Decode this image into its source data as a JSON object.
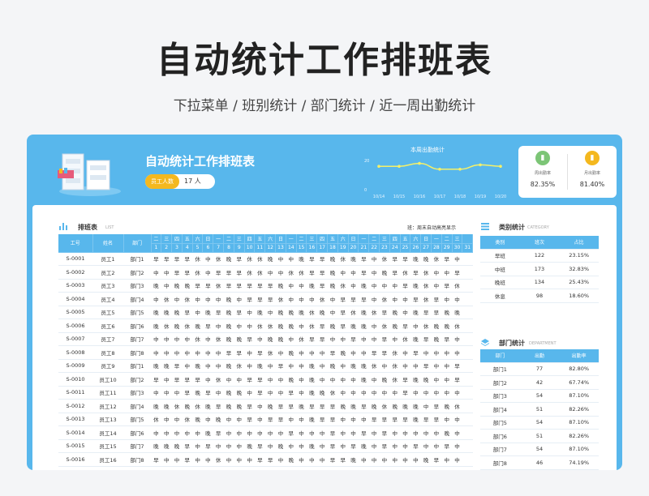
{
  "page_title": "自动统计工作排班表",
  "page_subtitle": "下拉菜单 / 班别统计 / 部门统计 / 近一周出勤统计",
  "header": {
    "title": "自动统计工作排班表",
    "staff_label": "员工人数",
    "staff_count": "17 人",
    "weekly_title": "本周出勤统计"
  },
  "stats": [
    {
      "label": "周出勤率",
      "value": "82.35%",
      "color": "#7cc576",
      "icon": "bar-icon"
    },
    {
      "label": "月出勤率",
      "value": "81.40%",
      "color": "#f4b81e",
      "icon": "bar-icon"
    }
  ],
  "chart_data": {
    "type": "line",
    "title": "本周出勤统计",
    "x": [
      "10/14",
      "10/15",
      "10/16",
      "10/17",
      "10/18",
      "10/19",
      "10/20"
    ],
    "values": [
      16,
      16,
      18,
      14,
      14,
      17,
      16
    ],
    "ylim": [
      0,
      20
    ],
    "yticks": [
      "20",
      "0"
    ],
    "color": "#f4f06a"
  },
  "schedule": {
    "title": "排班表",
    "title_en": "LIST",
    "note": "班：周末自动高亮显示",
    "col_id": "工号",
    "col_name": "姓名",
    "col_dept": "部门",
    "weekdays": [
      "二",
      "三",
      "四",
      "五",
      "六",
      "日",
      "一",
      "二",
      "三",
      "四",
      "五",
      "六",
      "日",
      "一",
      "二",
      "三",
      "四",
      "五",
      "六",
      "日",
      "一",
      "二",
      "三",
      "四",
      "五",
      "六",
      "日",
      "一",
      "二",
      "三"
    ],
    "days": [
      "1",
      "2",
      "3",
      "4",
      "5",
      "6",
      "7",
      "8",
      "9",
      "10",
      "11",
      "12",
      "13",
      "14",
      "15",
      "16",
      "17",
      "18",
      "19",
      "20",
      "21",
      "22",
      "23",
      "24",
      "25",
      "26",
      "27",
      "28",
      "29",
      "30",
      "31"
    ],
    "rows": [
      {
        "id": "S-0001",
        "name": "员工1",
        "dept": "部门1",
        "shifts": [
          "早",
          "早",
          "早",
          "早",
          "休",
          "中",
          "休",
          "晚",
          "早",
          "休",
          "休",
          "晚",
          "中",
          "中",
          "晚",
          "早",
          "早",
          "晚",
          "休",
          "晚",
          "早",
          "中",
          "休",
          "早",
          "早",
          "晚",
          "晚",
          "休",
          "早",
          "中"
        ]
      },
      {
        "id": "S-0002",
        "name": "员工2",
        "dept": "部门2",
        "shifts": [
          "中",
          "中",
          "早",
          "早",
          "休",
          "中",
          "早",
          "早",
          "早",
          "休",
          "休",
          "中",
          "中",
          "休",
          "休",
          "早",
          "早",
          "晚",
          "中",
          "中",
          "早",
          "中",
          "晚",
          "早",
          "休",
          "早",
          "休",
          "中",
          "中",
          "早"
        ]
      },
      {
        "id": "S-0003",
        "name": "员工3",
        "dept": "部门3",
        "shifts": [
          "晚",
          "中",
          "晚",
          "晚",
          "早",
          "早",
          "休",
          "早",
          "早",
          "早",
          "早",
          "早",
          "晚",
          "中",
          "中",
          "晚",
          "早",
          "晚",
          "休",
          "中",
          "晚",
          "中",
          "中",
          "中",
          "早",
          "晚",
          "休",
          "中",
          "早",
          "休"
        ]
      },
      {
        "id": "S-0004",
        "name": "员工4",
        "dept": "部门4",
        "shifts": [
          "中",
          "休",
          "中",
          "休",
          "中",
          "中",
          "中",
          "晚",
          "中",
          "早",
          "早",
          "早",
          "休",
          "中",
          "中",
          "中",
          "休",
          "中",
          "早",
          "早",
          "早",
          "中",
          "休",
          "中",
          "中",
          "早",
          "休",
          "早",
          "中",
          "中"
        ]
      },
      {
        "id": "S-0005",
        "name": "员工5",
        "dept": "部门5",
        "shifts": [
          "晚",
          "晚",
          "晚",
          "早",
          "中",
          "晚",
          "早",
          "晚",
          "早",
          "中",
          "晚",
          "中",
          "晚",
          "晚",
          "晚",
          "休",
          "晚",
          "中",
          "早",
          "休",
          "晚",
          "休",
          "早",
          "晚",
          "中",
          "晚",
          "早",
          "早",
          "晚",
          "晚"
        ]
      },
      {
        "id": "S-0006",
        "name": "员工6",
        "dept": "部门6",
        "shifts": [
          "晚",
          "休",
          "晚",
          "休",
          "晚",
          "早",
          "中",
          "晚",
          "中",
          "中",
          "休",
          "休",
          "晚",
          "晚",
          "中",
          "休",
          "早",
          "晚",
          "早",
          "晚",
          "晚",
          "中",
          "休",
          "晚",
          "早",
          "中",
          "休",
          "晚",
          "晚",
          "休"
        ]
      },
      {
        "id": "S-0007",
        "name": "员工7",
        "dept": "部门7",
        "shifts": [
          "中",
          "中",
          "中",
          "中",
          "休",
          "中",
          "休",
          "晚",
          "晚",
          "早",
          "中",
          "晚",
          "晚",
          "中",
          "休",
          "早",
          "早",
          "中",
          "中",
          "早",
          "中",
          "中",
          "早",
          "中",
          "休",
          "晚",
          "早",
          "晚",
          "早",
          "中"
        ]
      },
      {
        "id": "S-0008",
        "name": "员工8",
        "dept": "部门8",
        "shifts": [
          "中",
          "中",
          "中",
          "中",
          "中",
          "中",
          "中",
          "早",
          "早",
          "中",
          "早",
          "休",
          "中",
          "晚",
          "中",
          "中",
          "中",
          "早",
          "晚",
          "中",
          "中",
          "早",
          "早",
          "休",
          "中",
          "早",
          "中",
          "中",
          "中",
          "中"
        ]
      },
      {
        "id": "S-0009",
        "name": "员工9",
        "dept": "部门1",
        "shifts": [
          "晚",
          "晚",
          "早",
          "中",
          "晚",
          "中",
          "中",
          "晚",
          "休",
          "中",
          "晚",
          "中",
          "早",
          "中",
          "中",
          "晚",
          "中",
          "晚",
          "中",
          "晚",
          "晚",
          "休",
          "中",
          "休",
          "中",
          "中",
          "早",
          "中",
          "中",
          "早"
        ]
      },
      {
        "id": "S-0010",
        "name": "员工10",
        "dept": "部门2",
        "shifts": [
          "早",
          "中",
          "早",
          "早",
          "早",
          "中",
          "休",
          "中",
          "中",
          "早",
          "早",
          "中",
          "中",
          "晚",
          "中",
          "晚",
          "中",
          "中",
          "中",
          "中",
          "晚",
          "中",
          "晚",
          "休",
          "早",
          "晚",
          "晚",
          "中",
          "中",
          "早"
        ]
      },
      {
        "id": "S-0011",
        "name": "员工11",
        "dept": "部门3",
        "shifts": [
          "中",
          "中",
          "中",
          "早",
          "晚",
          "早",
          "中",
          "晚",
          "晚",
          "中",
          "早",
          "中",
          "中",
          "早",
          "中",
          "晚",
          "晚",
          "休",
          "中",
          "中",
          "中",
          "中",
          "中",
          "中",
          "早",
          "中",
          "中",
          "中",
          "中",
          "中"
        ]
      },
      {
        "id": "S-0012",
        "name": "员工12",
        "dept": "部门4",
        "shifts": [
          "晚",
          "晚",
          "休",
          "晚",
          "休",
          "晚",
          "早",
          "晚",
          "晚",
          "早",
          "中",
          "晚",
          "早",
          "早",
          "晚",
          "早",
          "早",
          "早",
          "晚",
          "晚",
          "早",
          "晚",
          "休",
          "晚",
          "晚",
          "晚",
          "中",
          "早",
          "晚",
          "休"
        ]
      },
      {
        "id": "S-0013",
        "name": "员工13",
        "dept": "部门5",
        "shifts": [
          "休",
          "中",
          "中",
          "休",
          "晚",
          "中",
          "晚",
          "中",
          "中",
          "早",
          "中",
          "早",
          "早",
          "中",
          "中",
          "晚",
          "早",
          "早",
          "中",
          "中",
          "中",
          "早",
          "早",
          "早",
          "早",
          "晚",
          "早",
          "早",
          "中",
          "中"
        ]
      },
      {
        "id": "S-0014",
        "name": "员工14",
        "dept": "部门6",
        "shifts": [
          "中",
          "中",
          "中",
          "中",
          "中",
          "晚",
          "早",
          "中",
          "中",
          "中",
          "中",
          "中",
          "中",
          "早",
          "中",
          "中",
          "中",
          "早",
          "中",
          "中",
          "早",
          "中",
          "早",
          "中",
          "中",
          "中",
          "中",
          "中",
          "晚",
          "中"
        ]
      },
      {
        "id": "S-0015",
        "name": "员工15",
        "dept": "部门7",
        "shifts": [
          "晚",
          "晚",
          "晚",
          "早",
          "中",
          "早",
          "中",
          "中",
          "中",
          "晚",
          "早",
          "中",
          "晚",
          "中",
          "中",
          "晚",
          "中",
          "早",
          "中",
          "早",
          "晚",
          "中",
          "早",
          "中",
          "中",
          "早",
          "中",
          "中",
          "早",
          "中"
        ]
      },
      {
        "id": "S-0016",
        "name": "员工16",
        "dept": "部门8",
        "shifts": [
          "早",
          "中",
          "中",
          "早",
          "中",
          "中",
          "休",
          "中",
          "中",
          "中",
          "早",
          "早",
          "中",
          "晚",
          "中",
          "中",
          "中",
          "早",
          "早",
          "晚",
          "中",
          "中",
          "中",
          "中",
          "中",
          "中",
          "晚",
          "早",
          "中",
          "中"
        ]
      }
    ]
  },
  "category": {
    "title": "类别统计",
    "title_en": "CATEGORY",
    "headers": [
      "类别",
      "班次",
      "占比"
    ],
    "rows": [
      {
        "a": "早班",
        "b": "122",
        "c": "23.15%"
      },
      {
        "a": "中班",
        "b": "173",
        "c": "32.83%"
      },
      {
        "a": "晚班",
        "b": "134",
        "c": "25.43%"
      },
      {
        "a": "休息",
        "b": "98",
        "c": "18.60%"
      }
    ]
  },
  "department": {
    "title": "部门统计",
    "title_en": "DEPARTMENT",
    "headers": [
      "部门",
      "出勤",
      "出勤率"
    ],
    "rows": [
      {
        "a": "部门1",
        "b": "77",
        "c": "82.80%"
      },
      {
        "a": "部门2",
        "b": "42",
        "c": "67.74%"
      },
      {
        "a": "部门3",
        "b": "54",
        "c": "87.10%"
      },
      {
        "a": "部门4",
        "b": "51",
        "c": "82.26%"
      },
      {
        "a": "部门5",
        "b": "54",
        "c": "87.10%"
      },
      {
        "a": "部门6",
        "b": "51",
        "c": "82.26%"
      },
      {
        "a": "部门7",
        "b": "54",
        "c": "87.10%"
      },
      {
        "a": "部门8",
        "b": "46",
        "c": "74.19%"
      }
    ]
  }
}
